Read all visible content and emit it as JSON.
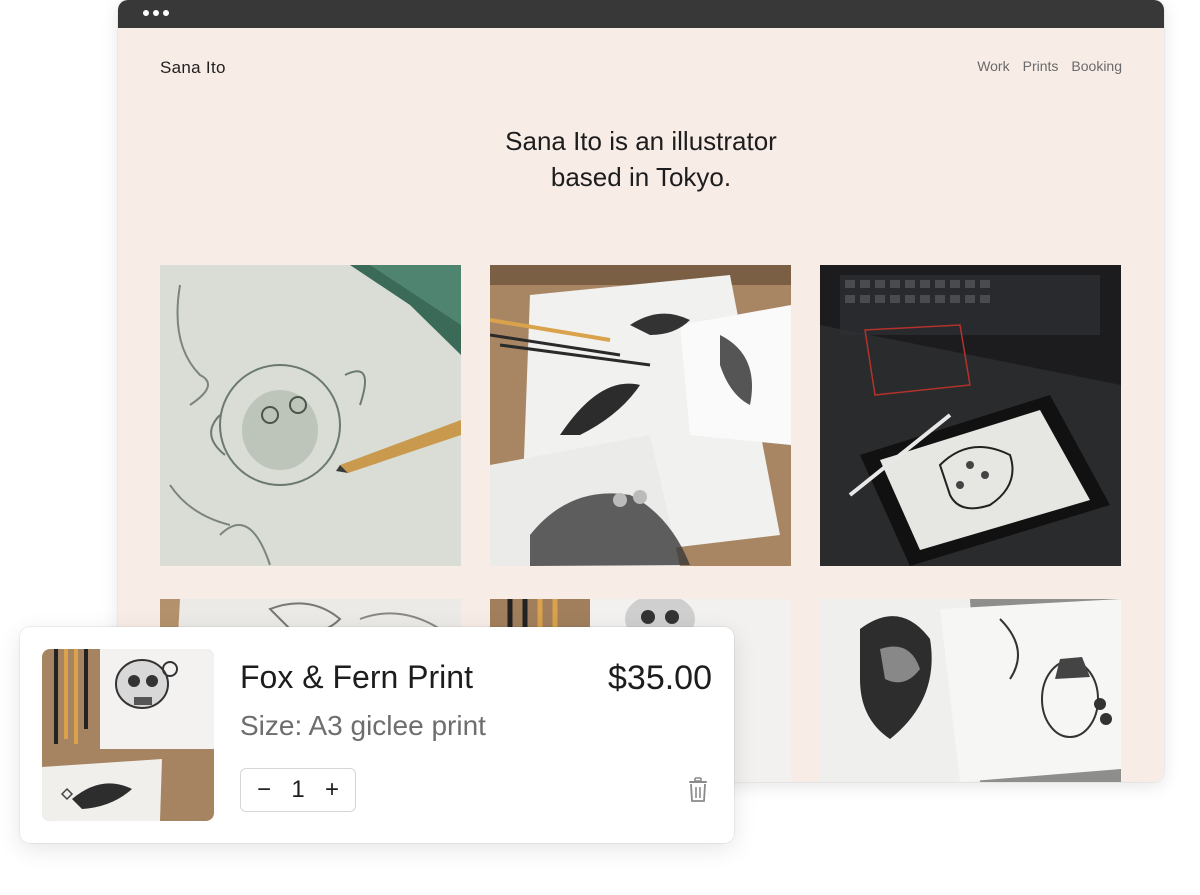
{
  "site": {
    "logo": "Sana Ito",
    "nav": [
      "Work",
      "Prints",
      "Booking"
    ],
    "hero_line1": "Sana Ito is an illustrator",
    "hero_line2": "based in Tokyo.",
    "background": "#f8ece7"
  },
  "gallery": {
    "images": [
      "pencil-sketch-monkey-photo",
      "swallow-ink-drawings-photo",
      "tablet-leopard-drawing-photo",
      "sketch-sheets-photo",
      "skull-drawing-photo",
      "tattoo-flash-drawings-photo"
    ]
  },
  "cart_item": {
    "name": "Fox & Fern Print",
    "price": "$35.00",
    "size": "Size: A3 giclee print",
    "quantity": "1",
    "minus": "−",
    "plus": "+",
    "thumbnail": "skull-and-swallow-prints-photo",
    "delete_icon": "trash-icon"
  }
}
